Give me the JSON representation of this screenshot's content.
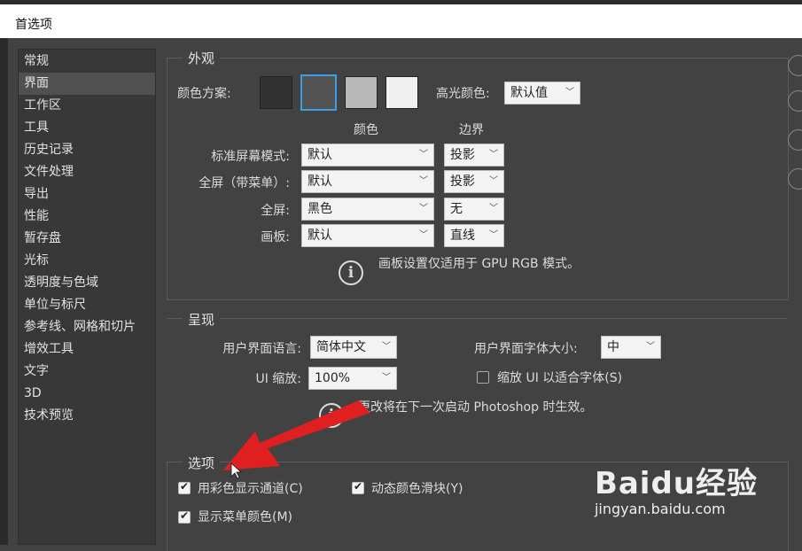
{
  "window": {
    "title": "首选项"
  },
  "sidebar": {
    "items": [
      {
        "label": "常规",
        "selected": false
      },
      {
        "label": "界面",
        "selected": true
      },
      {
        "label": "工作区",
        "selected": false
      },
      {
        "label": "工具",
        "selected": false
      },
      {
        "label": "历史记录",
        "selected": false
      },
      {
        "label": "文件处理",
        "selected": false
      },
      {
        "label": "导出",
        "selected": false
      },
      {
        "label": "性能",
        "selected": false
      },
      {
        "label": "暂存盘",
        "selected": false
      },
      {
        "label": "光标",
        "selected": false
      },
      {
        "label": "透明度与色域",
        "selected": false
      },
      {
        "label": "单位与标尺",
        "selected": false
      },
      {
        "label": "参考线、网格和切片",
        "selected": false
      },
      {
        "label": "增效工具",
        "selected": false
      },
      {
        "label": "文字",
        "selected": false
      },
      {
        "label": "3D",
        "selected": false
      },
      {
        "label": "技术预览",
        "selected": false
      }
    ]
  },
  "appearance": {
    "group_label": "外观",
    "color_scheme_label": "颜色方案:",
    "swatches": [
      {
        "color": "#323232",
        "selected": false
      },
      {
        "color": "#535353",
        "selected": true
      },
      {
        "color": "#b8b8b8",
        "selected": false
      },
      {
        "color": "#f0f0f0",
        "selected": false
      }
    ],
    "highlight_label": "高光颜色:",
    "highlight_value": "默认值",
    "col_color_header": "颜色",
    "col_border_header": "边界",
    "rows": [
      {
        "label": "标准屏幕模式:",
        "color": "默认",
        "border": "投影"
      },
      {
        "label": "全屏（带菜单）:",
        "color": "默认",
        "border": "投影"
      },
      {
        "label": "全屏:",
        "color": "黑色",
        "border": "无"
      },
      {
        "label": "画板:",
        "color": "默认",
        "border": "直线"
      }
    ],
    "info_text": "画板设置仅适用于 GPU RGB 模式。"
  },
  "presentation": {
    "group_label": "呈现",
    "ui_language_label": "用户界面语言:",
    "ui_language_value": "简体中文",
    "ui_font_size_label": "用户界面字体大小:",
    "ui_font_size_value": "中",
    "ui_scale_label": "UI 缩放:",
    "ui_scale_value": "100%",
    "scale_to_font_label": "缩放 UI 以适合字体(S)",
    "scale_to_font_checked": false,
    "info_text": "更改将在下一次启动 Photoshop 时生效。"
  },
  "options": {
    "group_label": "选项",
    "color_channels_label": "用彩色显示通道(C)",
    "color_channels_checked": true,
    "dynamic_sliders_label": "动态颜色滑块(Y)",
    "dynamic_sliders_checked": true,
    "menu_colors_label": "显示菜单颜色(M)",
    "menu_colors_checked": true
  },
  "annotation": {
    "arrow_color": "#e02020"
  },
  "watermark": {
    "main": "Baidu经验",
    "sub": "jingyan.baidu.com"
  }
}
